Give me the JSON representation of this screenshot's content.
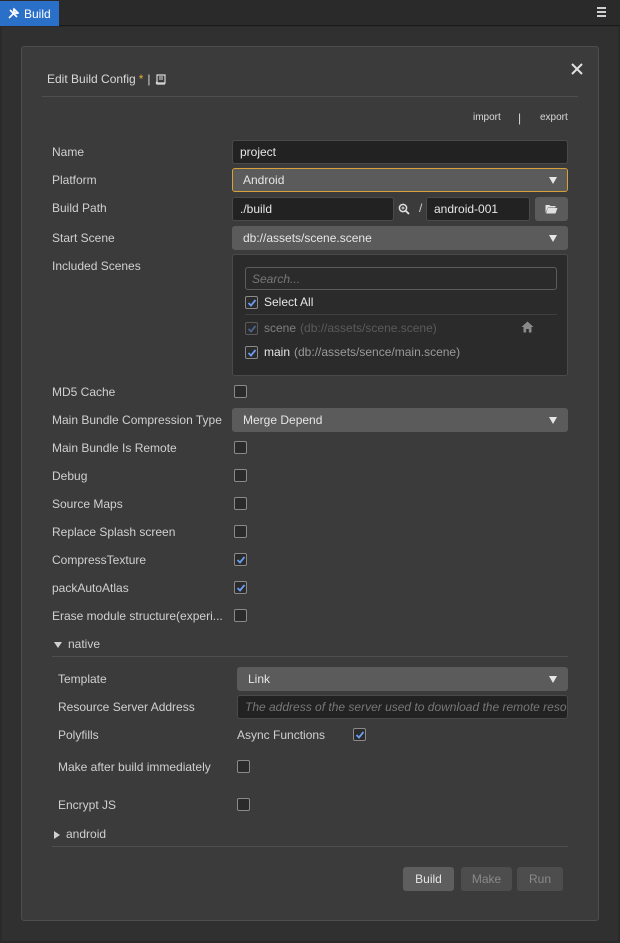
{
  "window": {
    "tab_label": "Build"
  },
  "dialog": {
    "title": "Edit Build Config",
    "modified_marker": "*",
    "title_separator": "|",
    "import_label": "import",
    "export_label": "export",
    "import_export_separator": "|"
  },
  "form": {
    "name": {
      "label": "Name",
      "value": "project"
    },
    "platform": {
      "label": "Platform",
      "value": "Android"
    },
    "build_path": {
      "label": "Build Path",
      "path": "./build",
      "separator": "/",
      "folder": "android-001"
    },
    "start_scene": {
      "label": "Start Scene",
      "value": "db://assets/scene.scene"
    },
    "included_scenes": {
      "label": "Included Scenes",
      "search_placeholder": "Search...",
      "select_all_label": "Select All",
      "select_all_checked": true,
      "items": [
        {
          "name": "scene",
          "path": "(db://assets/scene.scene)",
          "checked": true,
          "disabled": true
        },
        {
          "name": "main",
          "path": "(db://assets/sence/main.scene)",
          "checked": true,
          "disabled": false
        }
      ]
    },
    "md5_cache": {
      "label": "MD5 Cache",
      "checked": false
    },
    "compression_type": {
      "label": "Main Bundle Compression Type",
      "value": "Merge Depend"
    },
    "bundle_remote": {
      "label": "Main Bundle Is Remote",
      "checked": false
    },
    "debug": {
      "label": "Debug",
      "checked": false
    },
    "source_maps": {
      "label": "Source Maps",
      "checked": false
    },
    "replace_splash": {
      "label": "Replace Splash screen",
      "checked": false
    },
    "compress_texture": {
      "label": "CompressTexture",
      "checked": true
    },
    "pack_auto_atlas": {
      "label": "packAutoAtlas",
      "checked": true
    },
    "erase_module": {
      "label": "Erase module structure(experi...",
      "checked": false
    }
  },
  "native": {
    "section_label": "native",
    "template": {
      "label": "Template",
      "value": "Link"
    },
    "resource_server": {
      "label": "Resource Server Address",
      "placeholder": "The address of the server used to download the remote reso"
    },
    "polyfills": {
      "label": "Polyfills",
      "async_label": "Async Functions",
      "async_checked": true
    },
    "make_after_build": {
      "label": "Make after build immediately",
      "checked": false
    },
    "encrypt_js": {
      "label": "Encrypt JS",
      "checked": false
    }
  },
  "android": {
    "section_label": "android"
  },
  "actions": {
    "build": "Build",
    "make": "Make",
    "run": "Run"
  },
  "colors": {
    "accent_tab": "#2a6fc8",
    "focus_border": "#d8a23a",
    "modified_star": "#e0b030",
    "check": "#6a9cf0"
  }
}
